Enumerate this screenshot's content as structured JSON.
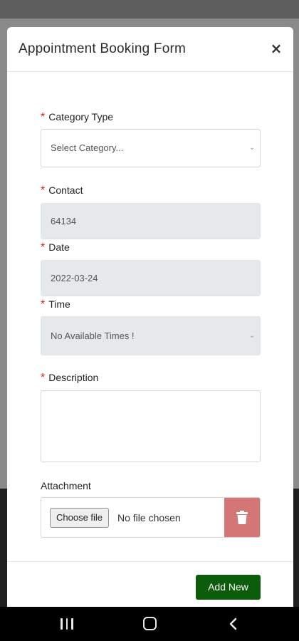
{
  "modal": {
    "title": "Appointment Booking Form",
    "close_symbol": "×"
  },
  "form": {
    "required_mark": "*",
    "category": {
      "label": "Category Type",
      "placeholder": "Select Category...",
      "chevron": "⌄"
    },
    "contact": {
      "label": "Contact",
      "value": "64134"
    },
    "date": {
      "label": "Date",
      "value": "2022-03-24"
    },
    "time": {
      "label": "Time",
      "value": "No Available Times !",
      "chevron": "⌄"
    },
    "description": {
      "label": "Description",
      "value": ""
    },
    "attachment": {
      "label": "Attachment",
      "choose_label": "Choose file",
      "status": "No file chosen",
      "delete_icon": "trash-icon"
    }
  },
  "footer": {
    "add_label": "Add New"
  },
  "colors": {
    "required": "#e02020",
    "add_button": "#0b5d0b",
    "delete_button": "#d47676",
    "disabled_field": "#e6e9ec"
  },
  "navbar": {
    "icons": [
      "recents-icon",
      "home-icon",
      "back-icon"
    ]
  }
}
